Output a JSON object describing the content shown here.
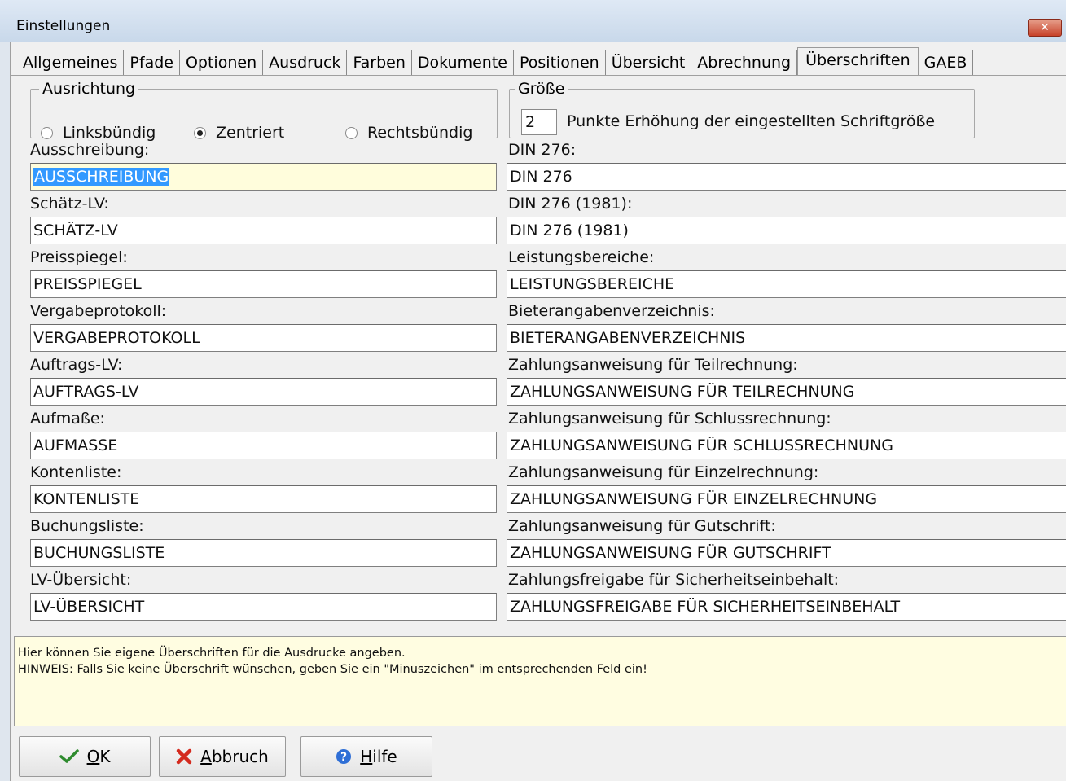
{
  "window": {
    "title": "Einstellungen",
    "close_symbol": "✕"
  },
  "tabs": [
    {
      "label": "Allgemeines",
      "active": false
    },
    {
      "label": "Pfade",
      "active": false
    },
    {
      "label": "Optionen",
      "active": false
    },
    {
      "label": "Ausdruck",
      "active": false
    },
    {
      "label": "Farben",
      "active": false
    },
    {
      "label": "Dokumente",
      "active": false
    },
    {
      "label": "Positionen",
      "active": false
    },
    {
      "label": "Übersicht",
      "active": false
    },
    {
      "label": "Abrechnung",
      "active": false
    },
    {
      "label": "Überschriften",
      "active": true
    },
    {
      "label": "GAEB",
      "active": false
    }
  ],
  "alignment": {
    "legend": "Ausrichtung",
    "options": [
      "Linksbündig",
      "Zentriert",
      "Rechtsbündig"
    ],
    "selected": "Zentriert"
  },
  "size": {
    "legend": "Größe",
    "value": "2",
    "label": "Punkte Erhöhung der eingestellten Schriftgröße"
  },
  "left_fields": [
    {
      "label": "Ausschreibung:",
      "value": "AUSSCHREIBUNG"
    },
    {
      "label": "Schätz-LV:",
      "value": "SCHÄTZ-LV"
    },
    {
      "label": "Preisspiegel:",
      "value": "PREISSPIEGEL"
    },
    {
      "label": "Vergabeprotokoll:",
      "value": "VERGABEPROTOKOLL"
    },
    {
      "label": "Auftrags-LV:",
      "value": "AUFTRAGS-LV"
    },
    {
      "label": "Aufmaße:",
      "value": "AUFMASSE"
    },
    {
      "label": "Kontenliste:",
      "value": "KONTENLISTE"
    },
    {
      "label": "Buchungsliste:",
      "value": "BUCHUNGSLISTE"
    },
    {
      "label": "LV-Übersicht:",
      "value": "LV-ÜBERSICHT"
    }
  ],
  "right_fields": [
    {
      "label": "DIN 276:",
      "value": "DIN 276"
    },
    {
      "label": "DIN 276 (1981):",
      "value": "DIN 276 (1981)"
    },
    {
      "label": "Leistungsbereiche:",
      "value": "LEISTUNGSBEREICHE"
    },
    {
      "label": "Bieterangabenverzeichnis:",
      "value": "BIETERANGABENVERZEICHNIS"
    },
    {
      "label": "Zahlungsanweisung für Teilrechnung:",
      "value": "ZAHLUNGSANWEISUNG FÜR TEILRECHNUNG"
    },
    {
      "label": "Zahlungsanweisung für Schlussrechnung:",
      "value": "ZAHLUNGSANWEISUNG FÜR SCHLUSSRECHNUNG"
    },
    {
      "label": "Zahlungsanweisung für Einzelrechnung:",
      "value": "ZAHLUNGSANWEISUNG FÜR EINZELRECHNUNG"
    },
    {
      "label": "Zahlungsanweisung für Gutschrift:",
      "value": "ZAHLUNGSANWEISUNG FÜR GUTSCHRIFT"
    },
    {
      "label": "Zahlungsfreigabe für Sicherheitseinbehalt:",
      "value": "ZAHLUNGSFREIGABE FÜR SICHERHEITSEINBEHALT"
    }
  ],
  "hint": {
    "line1": "Hier können Sie eigene Überschriften für die Ausdrucke angeben.",
    "line2": "HINWEIS: Falls Sie keine Überschrift wünschen, geben Sie ein \"Minuszeichen\" im entsprechenden Feld ein!"
  },
  "buttons": {
    "ok": {
      "first": "O",
      "rest": "K"
    },
    "cancel": {
      "first": "A",
      "rest": "bbruch"
    },
    "help": {
      "first": "H",
      "rest": "ilfe"
    }
  },
  "colors": {
    "ok_check": "#2e8b2e",
    "cancel_x": "#d42a1e",
    "help_blue": "#2f6fd6",
    "hint_bg": "#fffde1",
    "focused_field_bg": "#fffddc",
    "selection": "#3399ff"
  }
}
